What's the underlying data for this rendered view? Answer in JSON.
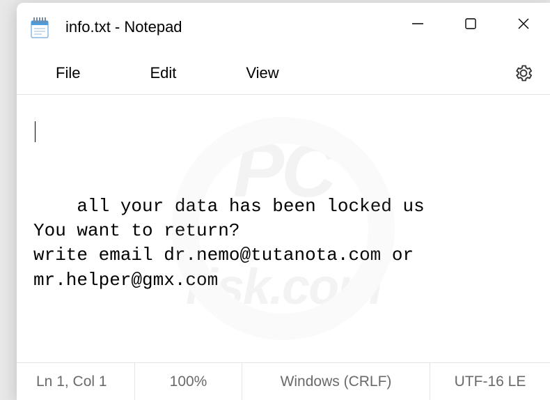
{
  "titlebar": {
    "title": "info.txt - Notepad"
  },
  "menu": {
    "file": "File",
    "edit": "Edit",
    "view": "View"
  },
  "content": {
    "text": "all your data has been locked us\nYou want to return?\nwrite email dr.nemo@tutanota.com or mr.helper@gmx.com"
  },
  "statusbar": {
    "cursor": "Ln 1, Col 1",
    "zoom": "100%",
    "eol": "Windows (CRLF)",
    "encoding": "UTF-16 LE"
  },
  "watermark": {
    "line1": "PC",
    "line2": "risk.com"
  }
}
